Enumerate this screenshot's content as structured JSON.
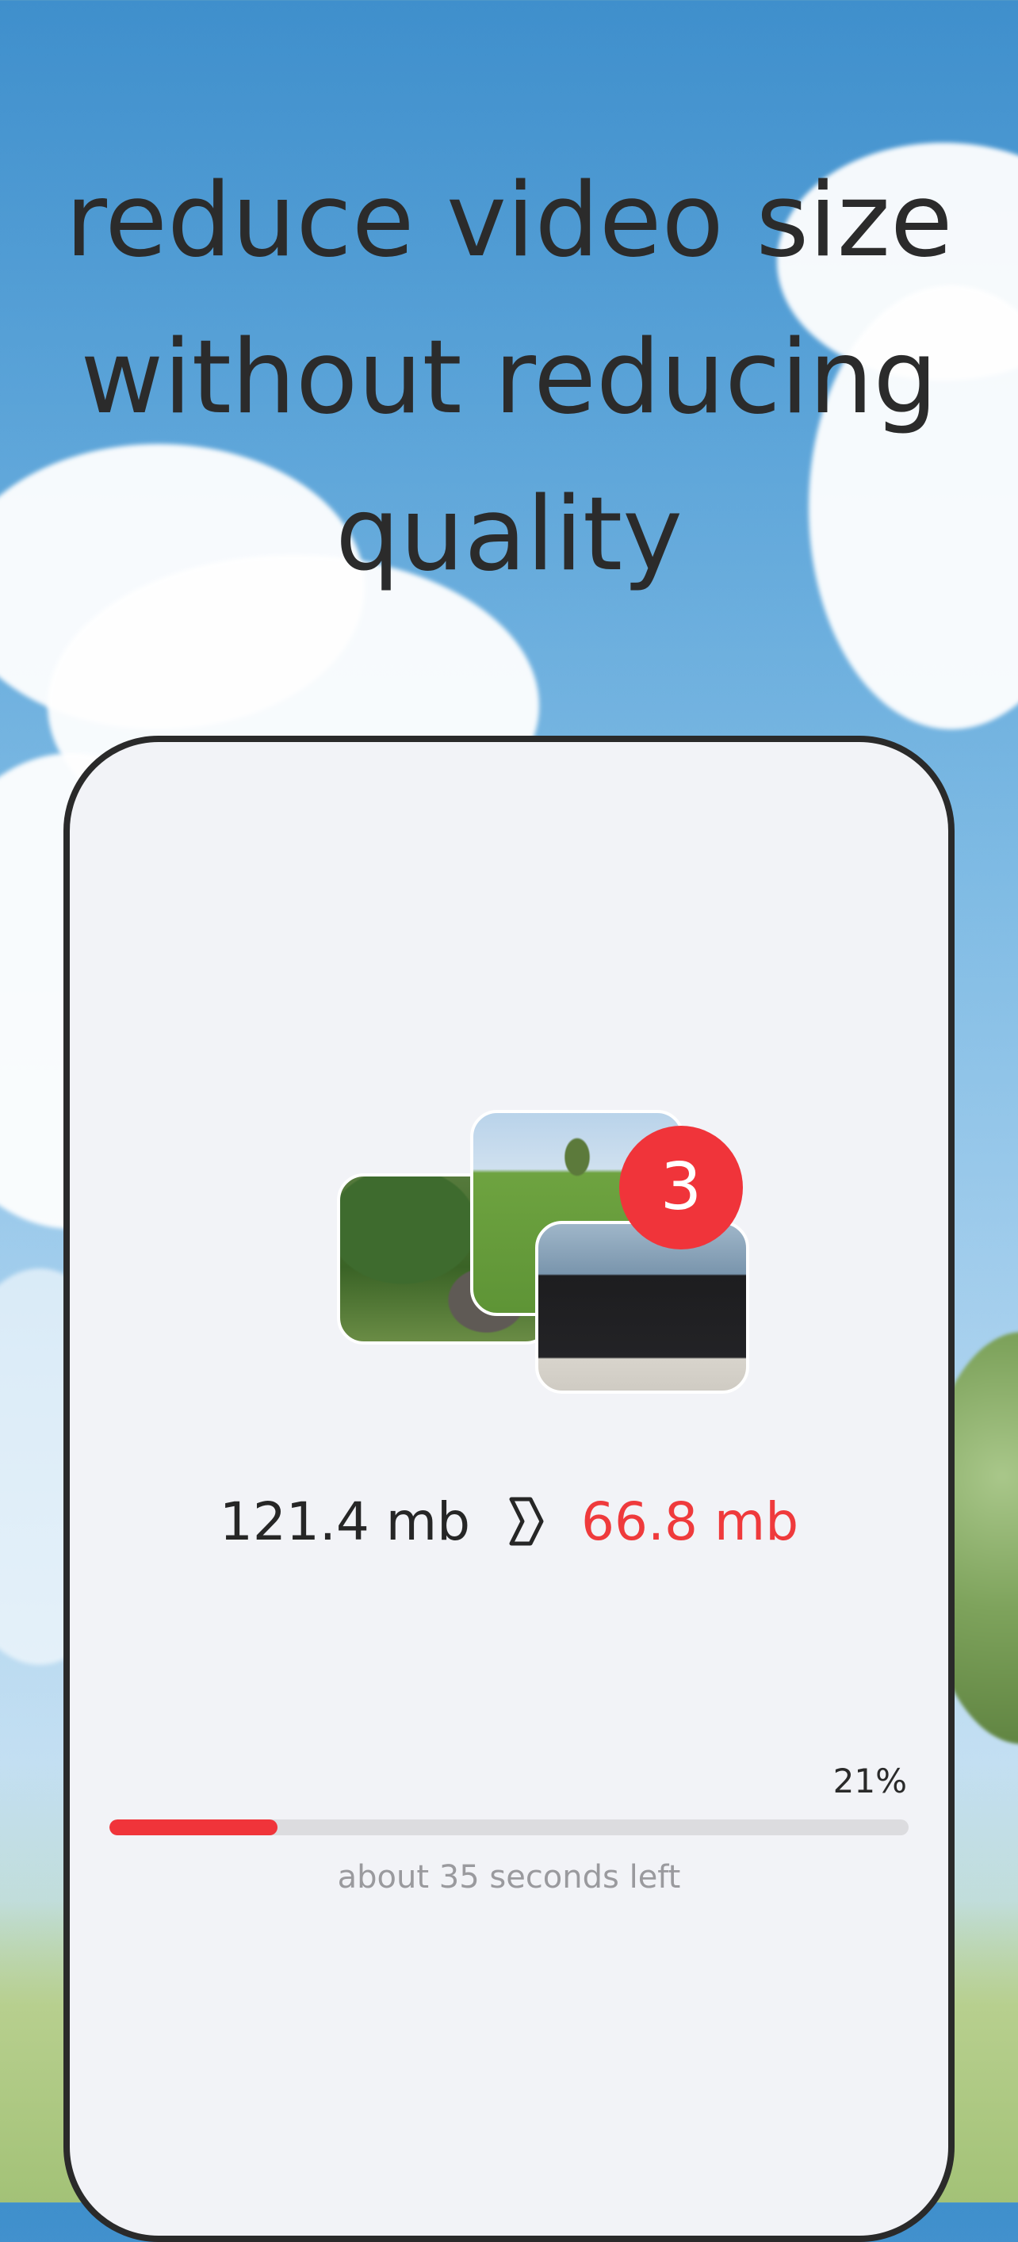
{
  "headline": {
    "line1": "reduce video size",
    "line2": "without reducing",
    "line3": "quality"
  },
  "thumbnails": {
    "count_badge": "3",
    "items": [
      {
        "name": "elephant-photo"
      },
      {
        "name": "golf-photo"
      },
      {
        "name": "graduation-photo"
      }
    ]
  },
  "sizes": {
    "original": "121.4 mb",
    "compressed": "66.8 mb",
    "arrow_icon": "chevron-right-icon"
  },
  "progress": {
    "percent_label": "21%",
    "value": 0.21,
    "eta": "about 35 seconds left"
  },
  "colors": {
    "accent": "#f0343a",
    "text": "#262626",
    "muted": "#9a9a9e",
    "card_bg": "#f2f3f7"
  }
}
